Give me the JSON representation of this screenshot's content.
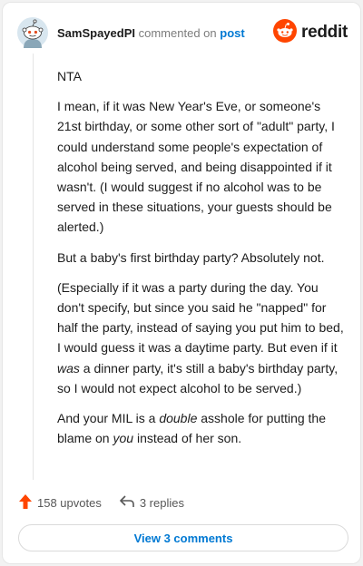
{
  "header": {
    "username": "SamSpayedPI",
    "action": "commented on",
    "post_link": "post",
    "logo_text": "reddit",
    "logo_icon": "reddit-snoo-icon",
    "avatar_icon": "snoo-avatar-icon"
  },
  "comment": {
    "paragraphs": [
      {
        "segments": [
          {
            "text": "NTA",
            "style": "normal"
          }
        ]
      },
      {
        "segments": [
          {
            "text": "I mean, if it was New Year's Eve, or someone's 21st birthday, or some other sort of \"adult\" party, I could understand some people's expectation of alcohol being served, and being disappointed if it wasn't. (I would suggest if no alcohol was to be served in these situations, your guests should be alerted.)",
            "style": "normal"
          }
        ]
      },
      {
        "segments": [
          {
            "text": "But a baby's first birthday party? Absolutely not.",
            "style": "normal"
          }
        ]
      },
      {
        "segments": [
          {
            "text": "(Especially if it was a party during the day. You don't specify, but since you said he \"napped\" for half the party, instead of saying you put him to bed, I would guess it was a daytime party. But even if it ",
            "style": "normal"
          },
          {
            "text": "was",
            "style": "italic"
          },
          {
            "text": " a dinner party, it's still a baby's birthday party, so I would not expect alcohol to be served.)",
            "style": "normal"
          }
        ]
      },
      {
        "segments": [
          {
            "text": "And your MIL is a ",
            "style": "normal"
          },
          {
            "text": "double",
            "style": "italic"
          },
          {
            "text": " asshole for putting the blame on ",
            "style": "normal"
          },
          {
            "text": "you",
            "style": "italic"
          },
          {
            "text": " instead of her son.",
            "style": "normal"
          }
        ]
      }
    ]
  },
  "footer": {
    "upvotes": "158 upvotes",
    "upvote_icon": "upvote-arrow-icon",
    "replies": "3 replies",
    "reply_icon": "reply-arrow-icon",
    "view_comments": "View 3 comments"
  },
  "colors": {
    "accent": "#ff4500",
    "link": "#0079d3"
  }
}
